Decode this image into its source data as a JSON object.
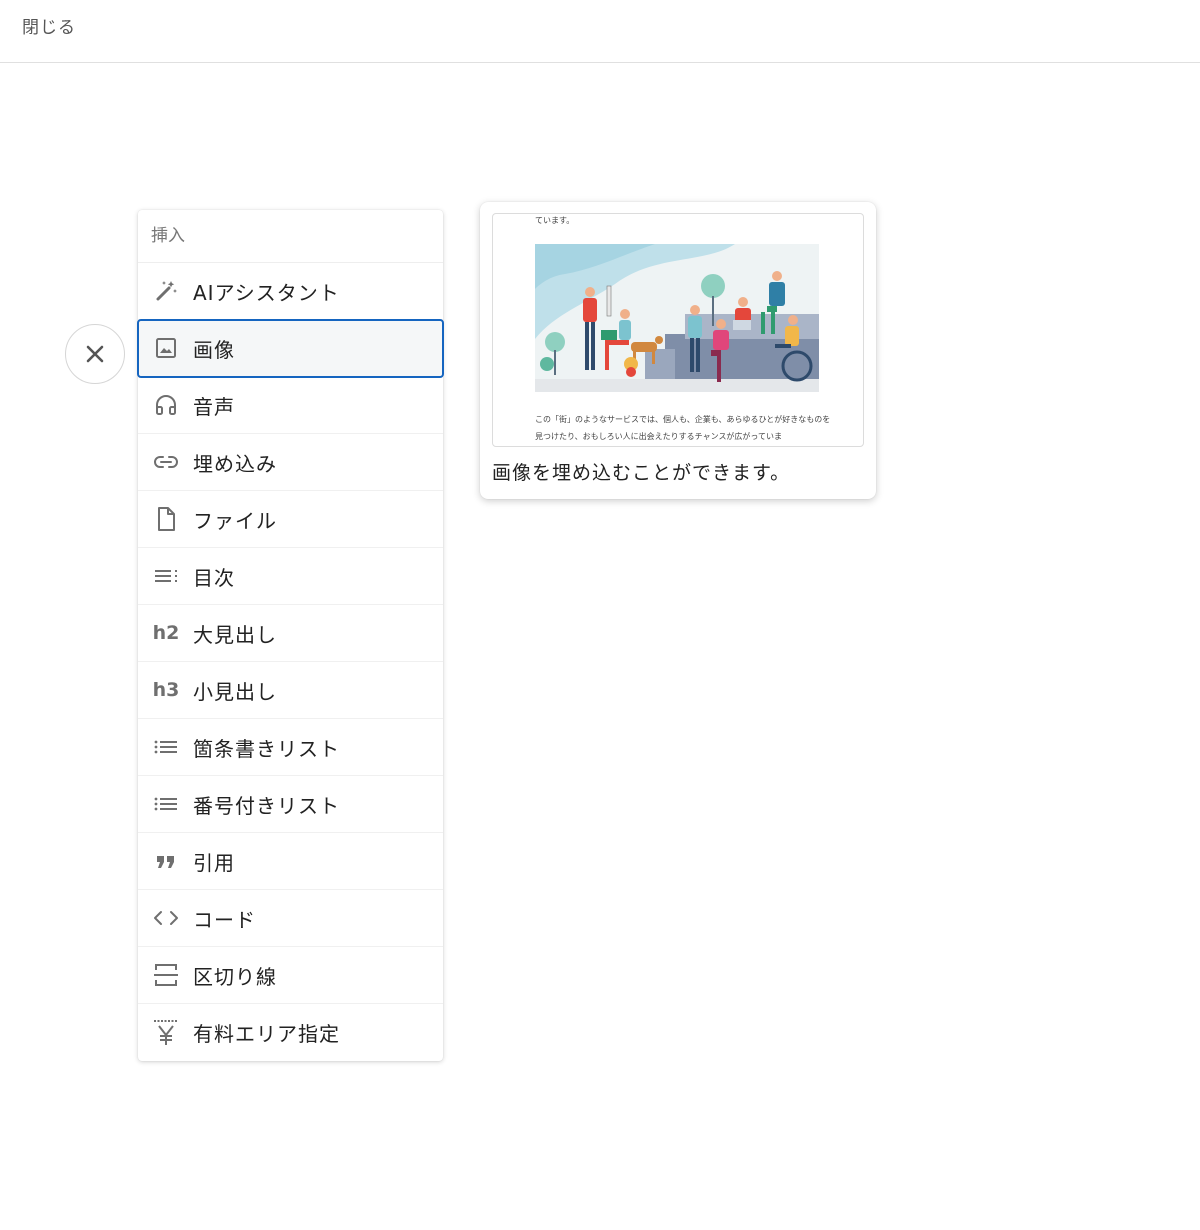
{
  "topbar": {
    "close_label": "閉じる"
  },
  "menu": {
    "header": "挿入",
    "items": [
      {
        "label": "AIアシスタント",
        "icon": "magic-wand-icon"
      },
      {
        "label": "画像",
        "icon": "image-icon",
        "selected": true
      },
      {
        "label": "音声",
        "icon": "headphones-icon"
      },
      {
        "label": "埋め込み",
        "icon": "link-icon"
      },
      {
        "label": "ファイル",
        "icon": "file-icon"
      },
      {
        "label": "目次",
        "icon": "toc-icon"
      },
      {
        "label": "大見出し",
        "icon": "h2",
        "icon_text": "h2"
      },
      {
        "label": "小見出し",
        "icon": "h3",
        "icon_text": "h3"
      },
      {
        "label": "箇条書きリスト",
        "icon": "bullet-list-icon"
      },
      {
        "label": "番号付きリスト",
        "icon": "numbered-list-icon"
      },
      {
        "label": "引用",
        "icon": "quote-icon",
        "icon_text": "❞"
      },
      {
        "label": "コード",
        "icon": "code-icon",
        "icon_text": "<>"
      },
      {
        "label": "区切り線",
        "icon": "divider-icon"
      },
      {
        "label": "有料エリア指定",
        "icon": "yen-icon",
        "icon_text": "¥"
      }
    ]
  },
  "preview": {
    "top_text": "ています。",
    "body_text": "この「街」のようなサービスでは、個人も、企業も、あらゆるひとが好きなものを見つけたり、おもしろい人に出会えたりするチャンスが広がっていま",
    "caption": "画像を埋め込むことができます。"
  },
  "colors": {
    "selected_outline": "#1565c0",
    "icon_gray": "#6f6f6f"
  }
}
